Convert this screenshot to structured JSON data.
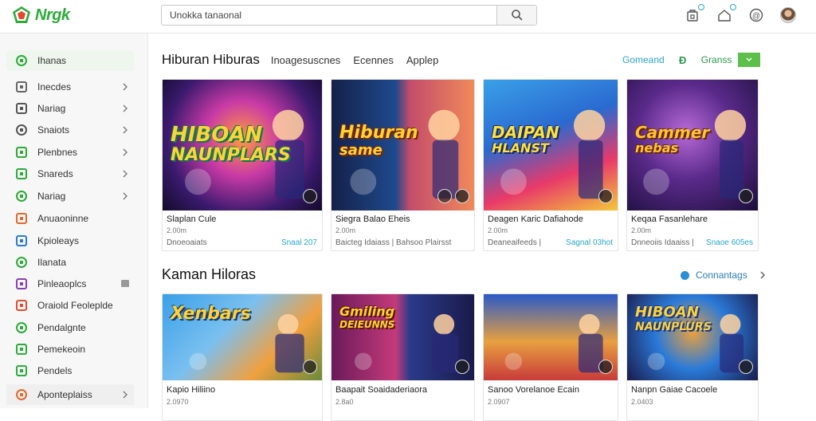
{
  "brand": {
    "name": "Nrgk",
    "accent": "#2cab3a"
  },
  "search": {
    "placeholder": "Unokka tanaonal",
    "icon": "search-icon"
  },
  "sidebar": {
    "items": [
      {
        "label": "Ihanas",
        "icon": "home-icon",
        "active": true
      },
      {
        "label": "Inecdes",
        "icon": "folder-icon"
      },
      {
        "label": "Nariag",
        "icon": "list-icon"
      },
      {
        "label": "Snaiots",
        "icon": "menu-icon"
      },
      {
        "label": "Plenbnes",
        "icon": "card-icon"
      },
      {
        "label": "Snareds",
        "icon": "dollar-icon"
      },
      {
        "label": "Nariag",
        "icon": "chat-icon"
      },
      {
        "label": "Anuaoninne",
        "icon": "grid-icon"
      },
      {
        "label": "Kpioleays",
        "icon": "globe-icon"
      },
      {
        "label": "Ilanata",
        "icon": "leaf-icon"
      },
      {
        "label": "Pinleaoplcs",
        "icon": "image-icon"
      },
      {
        "label": "Oraiold Feoleplde",
        "icon": "heart-icon"
      },
      {
        "label": "Pendalgnte",
        "icon": "gear-icon"
      },
      {
        "label": "Pemekeoin",
        "icon": "bag-icon"
      },
      {
        "label": "Pendels",
        "icon": "box-icon"
      },
      {
        "label": "Aponteplaiss",
        "icon": "app-icon"
      }
    ]
  },
  "section1": {
    "title": "Hiburan  Hiburas",
    "tabs": [
      "Inoagesuscnes",
      "Ecennes",
      "Applep"
    ],
    "right_link": "Gomeand",
    "right_label": "Granss"
  },
  "section1_cards": [
    {
      "art": "HIBOAN\nNAUNPLARS",
      "title": "Slaplan Cule",
      "num": "2.00m",
      "meta": "Dnoeoaiats",
      "price": "Snaal  207"
    },
    {
      "art": "Hiburan\nsame",
      "title": "Siegra Balao Eheis",
      "num": "2.00m",
      "meta": "Baicteg Idaiass  |  Bahsoo Plairsst",
      "price": ""
    },
    {
      "art": "DAIPAN\nHLANST",
      "title": "Deagen Karic Dafiahode",
      "num": "2.00m",
      "meta": "Deaneaifeeds  |",
      "price": "Sagnal 03hot"
    },
    {
      "art": "Cammer\nnebas",
      "title": "Keqaa Fasanlehare",
      "num": "2.00m",
      "meta": "Dnneoiis Idaaiss  |",
      "price": "Snaoe 605es"
    }
  ],
  "section2": {
    "title": "Kaman Hiloras",
    "right_link": "Connantags"
  },
  "section2_cards": [
    {
      "art": "Xenbars",
      "title": "Kapio Hiliino",
      "num": "2.0970"
    },
    {
      "art": "Gmiling\nDEIEUNNS",
      "title": "Baapait Soaidaderiaora",
      "num": "2.8a0"
    },
    {
      "art": "",
      "title": "Sanoo Vorelanoe Ecain",
      "num": "2.0907"
    },
    {
      "art": "HIBOAN\nNAUNPLURS",
      "title": "Nanpn Gaiae Cacoele",
      "num": "2.0403"
    }
  ]
}
